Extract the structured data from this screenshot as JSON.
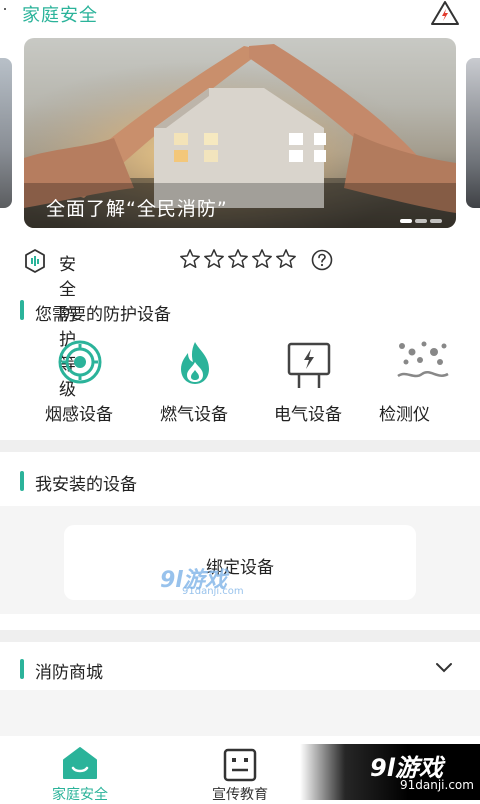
{
  "header": {
    "title": "家庭安全",
    "alert_icon": "electric-warning-icon"
  },
  "banner": {
    "caption": "全面了解“全民消防”",
    "page_count": 3,
    "active_page": 1
  },
  "safety_level": {
    "label": "安全防护等级",
    "stars_filled": 0,
    "stars_total": 5
  },
  "sections": {
    "devices_title": "您需要的防护设备",
    "installed_title": "我安装的设备",
    "shop_title": "消防商城"
  },
  "devices": [
    {
      "label": "烟感设备",
      "icon": "smoke-detector-icon"
    },
    {
      "label": "燃气设备",
      "icon": "gas-flame-icon"
    },
    {
      "label": "电气设备",
      "icon": "electric-panel-icon"
    },
    {
      "label": "检测仪",
      "icon": "particle-detector-icon"
    }
  ],
  "bind_device": {
    "label": "绑定设备"
  },
  "watermark": {
    "center_big": "9l游戏",
    "center_small": "91danji.com",
    "corner_big": "9l游戏",
    "corner_small": "91danji.com"
  },
  "bottom_nav": [
    {
      "label": "家庭安全",
      "active": true
    },
    {
      "label": "宣传教育",
      "active": false
    }
  ],
  "colors": {
    "accent": "#2bb39a",
    "text": "#222222",
    "muted": "#888888",
    "warning_red": "#e23b2e"
  }
}
